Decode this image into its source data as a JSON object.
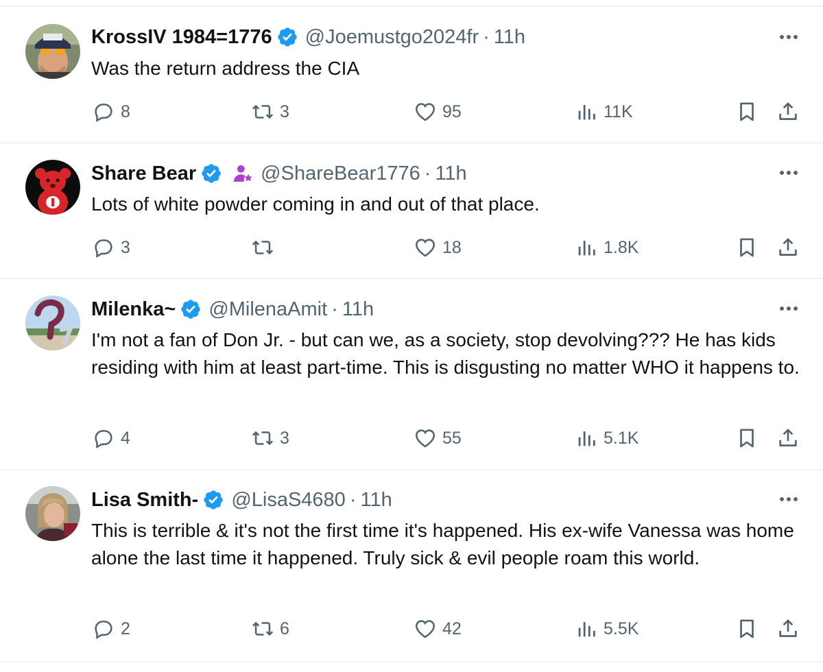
{
  "tweets": [
    {
      "name": "KrossIV 1984=1776",
      "handle": "@Joemustgo2024fr",
      "separator": "·",
      "time": "11h",
      "text": "Was the return address the CIA",
      "replies": "8",
      "retweets": "3",
      "likes": "95",
      "views": "11K",
      "avatar_icon": "man-with-cap-avatar"
    },
    {
      "name": "Share Bear",
      "handle": "@ShareBear1776",
      "separator": "·",
      "time": "11h",
      "text": "Lots of white powder coming in and out of that place.",
      "replies": "3",
      "retweets": "",
      "likes": "18",
      "views": "1.8K",
      "avatar_icon": "red-bear-avatar",
      "affiliation_icon": "person-star-icon"
    },
    {
      "name": "Milenka~",
      "handle": "@MilenaAmit",
      "separator": "·",
      "time": "11h",
      "text": "I'm not a fan of Don Jr. - but can we, as a society, stop devolving??? He has kids residing with him at least part-time. This is disgusting no matter WHO it happens to.",
      "replies": "4",
      "retweets": "3",
      "likes": "55",
      "views": "5.1K",
      "avatar_icon": "question-mark-avatar"
    },
    {
      "name": "Lisa Smith-",
      "handle": "@LisaS4680",
      "separator": "·",
      "time": "11h",
      "text": "This is terrible & it's not the first time it's happened. His ex-wife Vanessa was home alone the last time it happened.  Truly sick & evil people roam this world.",
      "replies": "2",
      "retweets": "6",
      "likes": "42",
      "views": "5.5K",
      "avatar_icon": "woman-portrait-avatar"
    }
  ],
  "colors": {
    "text_primary": "#0f1419",
    "text_secondary": "#536471",
    "verified_blue": "#1d9bf0",
    "divider": "#eff3f4",
    "affiliation_purple": "#b43ed1"
  }
}
